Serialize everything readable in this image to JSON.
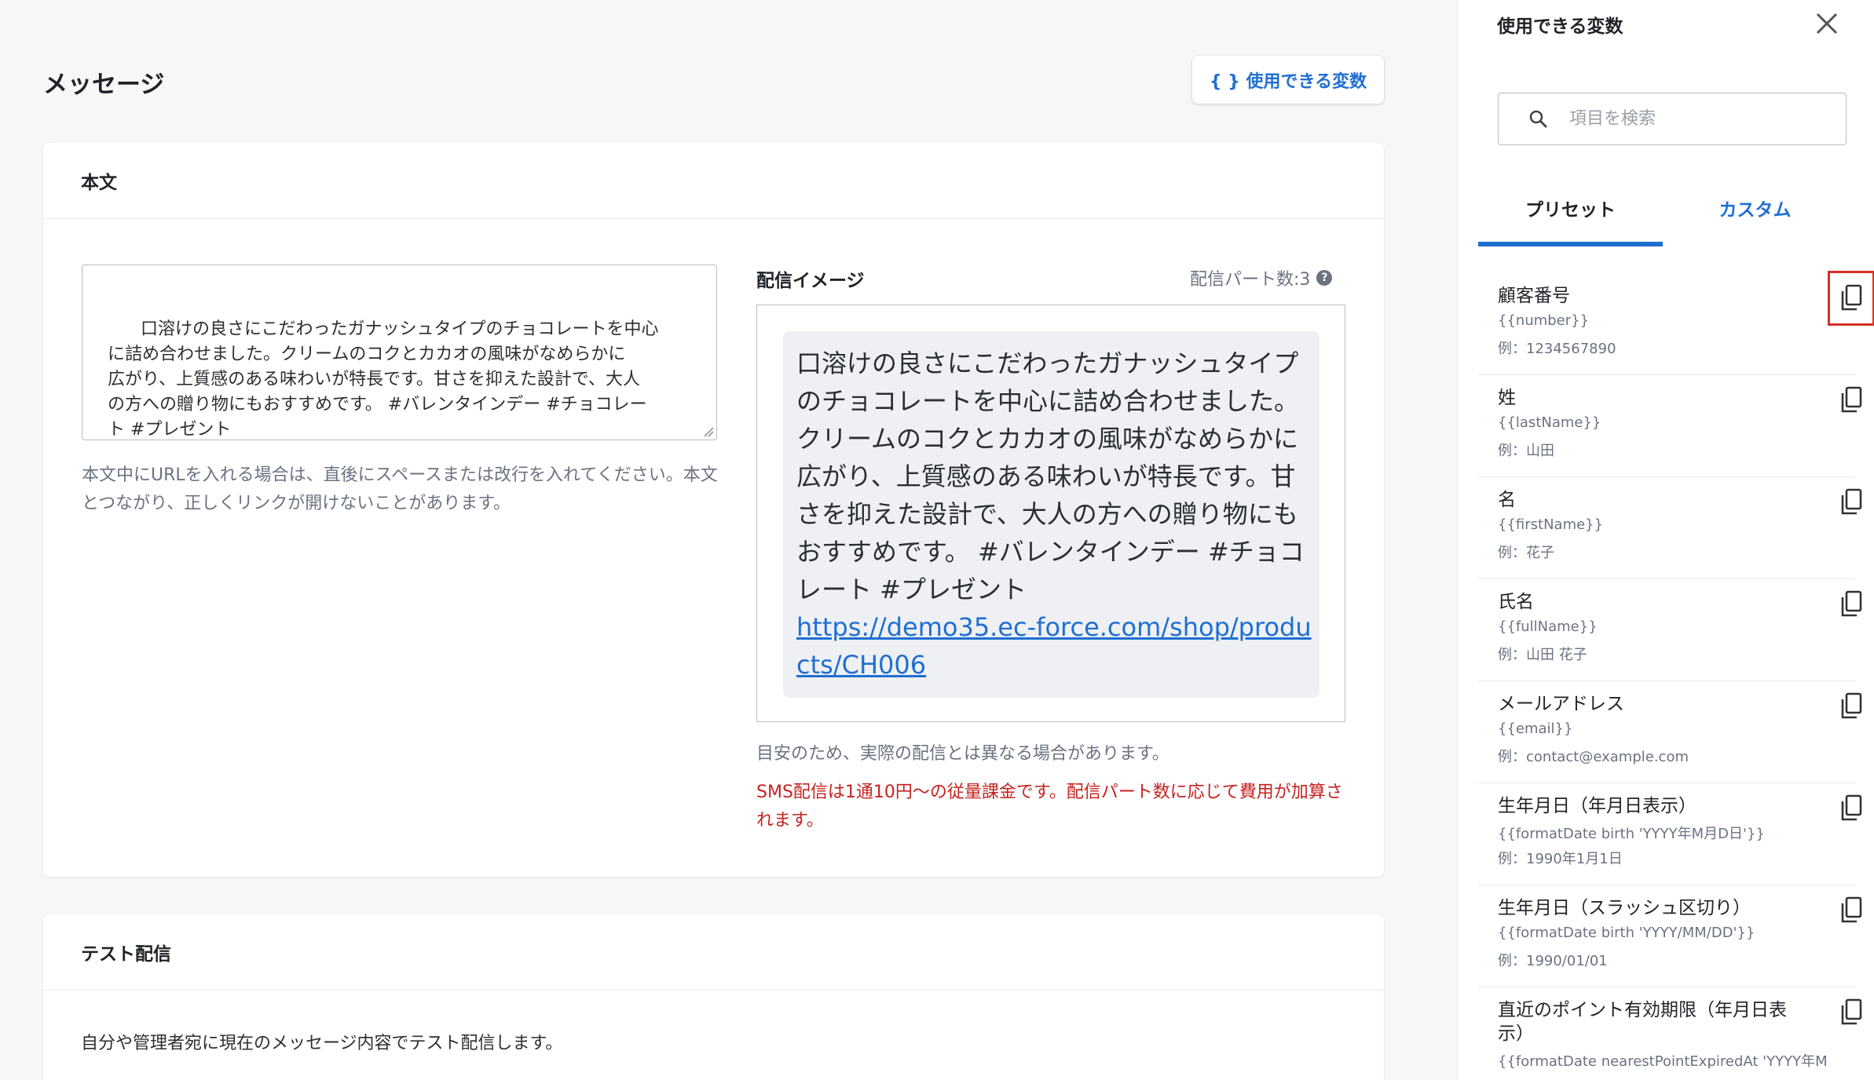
{
  "main": {
    "title": "メッセージ",
    "vars_button_label": "{ } 使用できる変数",
    "body_card": {
      "header": "本文",
      "textarea_value": "口溶けの良さにこだわったガナッシュタイプのチョコレートを中心\nに詰め合わせました。クリームのコクとカカオの風味がなめらかに\n広がり、上質感のある味わいが特長です。甘さを抑えた設計で、大人\nの方への贈り物にもおすすめです。 #バレンタインデー #チョコレー\nト #プレゼント\nhttps://demo35.ec-force.com/shop/products/CH006",
      "hint": "本文中にURLを入れる場合は、直後にスペースまたは改行を入れてください。本文とつながり、正しくリンクが開けないことがあります。",
      "preview_label": "配信イメージ",
      "parts_label": "配信パート数:3",
      "preview_text": "口溶けの良さにこだわったガナッシュタイプ\nのチョコレートを中心に詰め合わせました。\nクリームのコクとカカオの風味がなめらかに\n広がり、上質感のある味わいが特長です。甘\nさを抑えた設計で、大人の方への贈り物にも\nおすすめです。 #バレンタインデー #チョコ\nレート #プレゼント\n",
      "preview_link": "https://demo35.ec-force.com/shop/products/CH006",
      "note_gray": "目安のため、実際の配信とは異なる場合があります。",
      "note_red": "SMS配信は1通10円〜の従量課金です。配信パート数に応じて費用が加算されます。"
    },
    "test_card": {
      "header": "テスト配信",
      "description": "自分や管理者宛に現在のメッセージ内容でテスト配信します。"
    }
  },
  "panel": {
    "title": "使用できる変数",
    "search_placeholder": "項目を検索",
    "tabs": [
      "プリセット",
      "カスタム"
    ],
    "variables": [
      {
        "name": "顧客番号",
        "code": "{{number}}",
        "example": "例：1234567890"
      },
      {
        "name": "姓",
        "code": "{{lastName}}",
        "example": "例：山田"
      },
      {
        "name": "名",
        "code": "{{firstName}}",
        "example": "例：花子"
      },
      {
        "name": "氏名",
        "code": "{{fullName}}",
        "example": "例：山田 花子"
      },
      {
        "name": "メールアドレス",
        "code": "{{email}}",
        "example": "例：contact@example.com"
      },
      {
        "name": "生年月日（年月日表示）",
        "code": "{{formatDate birth 'YYYY年M月D日'}}",
        "example": "例：1990年1月1日"
      },
      {
        "name": "生年月日（スラッシュ区切り）",
        "code": "{{formatDate birth 'YYYY/MM/DD'}}",
        "example": "例：1990/01/01"
      },
      {
        "name": "直近のポイント有効期限（年月日表示）",
        "code": "{{formatDate nearestPointExpiredAt 'YYYY年M",
        "example": ""
      }
    ]
  },
  "colors": {
    "accent": "#1f6fd1",
    "warning": "#c5221f",
    "highlight_outline": "#d93025"
  }
}
